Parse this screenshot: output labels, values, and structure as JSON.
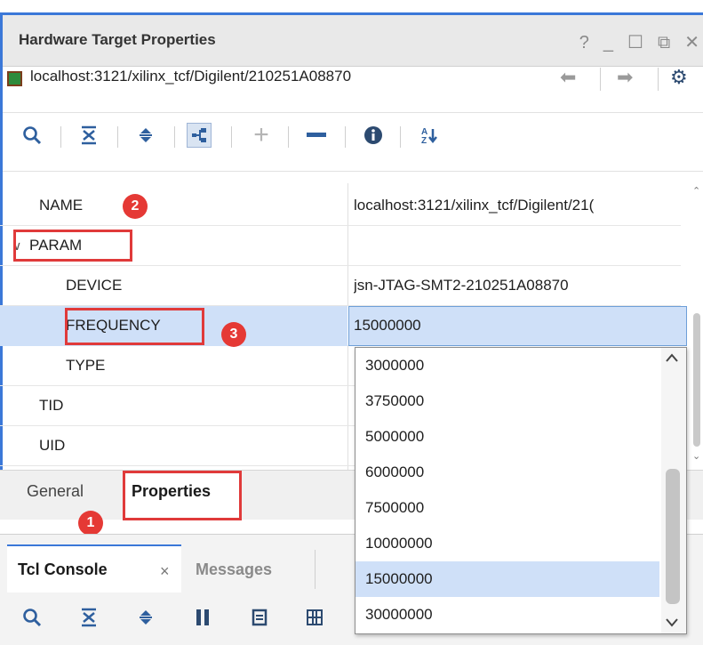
{
  "window": {
    "title": "Hardware Target Properties",
    "controls": [
      "?",
      "_",
      "☐",
      "⧉",
      "✕"
    ]
  },
  "path": {
    "text": "localhost:3121/xilinx_tcf/Digilent/210251A08870",
    "icon": "hardware-target-icon"
  },
  "properties": [
    {
      "name": "NAME",
      "value": "localhost:3121/xilinx_tcf/Digilent/21("
    },
    {
      "name": "PARAM",
      "value": "",
      "expanded": true
    },
    {
      "name": "DEVICE",
      "value": "jsn-JTAG-SMT2-210251A08870"
    },
    {
      "name": "FREQUENCY",
      "value": "15000000"
    },
    {
      "name": "TYPE",
      "value": ""
    },
    {
      "name": "TID",
      "value": ""
    },
    {
      "name": "UID",
      "value": ""
    }
  ],
  "expander": "∨",
  "annotations": {
    "badge1": "1",
    "badge2": "2",
    "badge3": "3"
  },
  "tabs": {
    "general": "General",
    "properties": "Properties",
    "active": "Properties"
  },
  "console": {
    "tcl_tab": "Tcl Console",
    "close": "×",
    "messages_tab": "Messages"
  },
  "frequency_dropdown": {
    "options": [
      "3000000",
      "3750000",
      "5000000",
      "6000000",
      "7500000",
      "10000000",
      "15000000",
      "30000000"
    ],
    "selected": "15000000"
  },
  "colors": {
    "panel_border": "#3b78d8",
    "selection": "#cfe0f8",
    "annotation_red": "#e53935"
  }
}
